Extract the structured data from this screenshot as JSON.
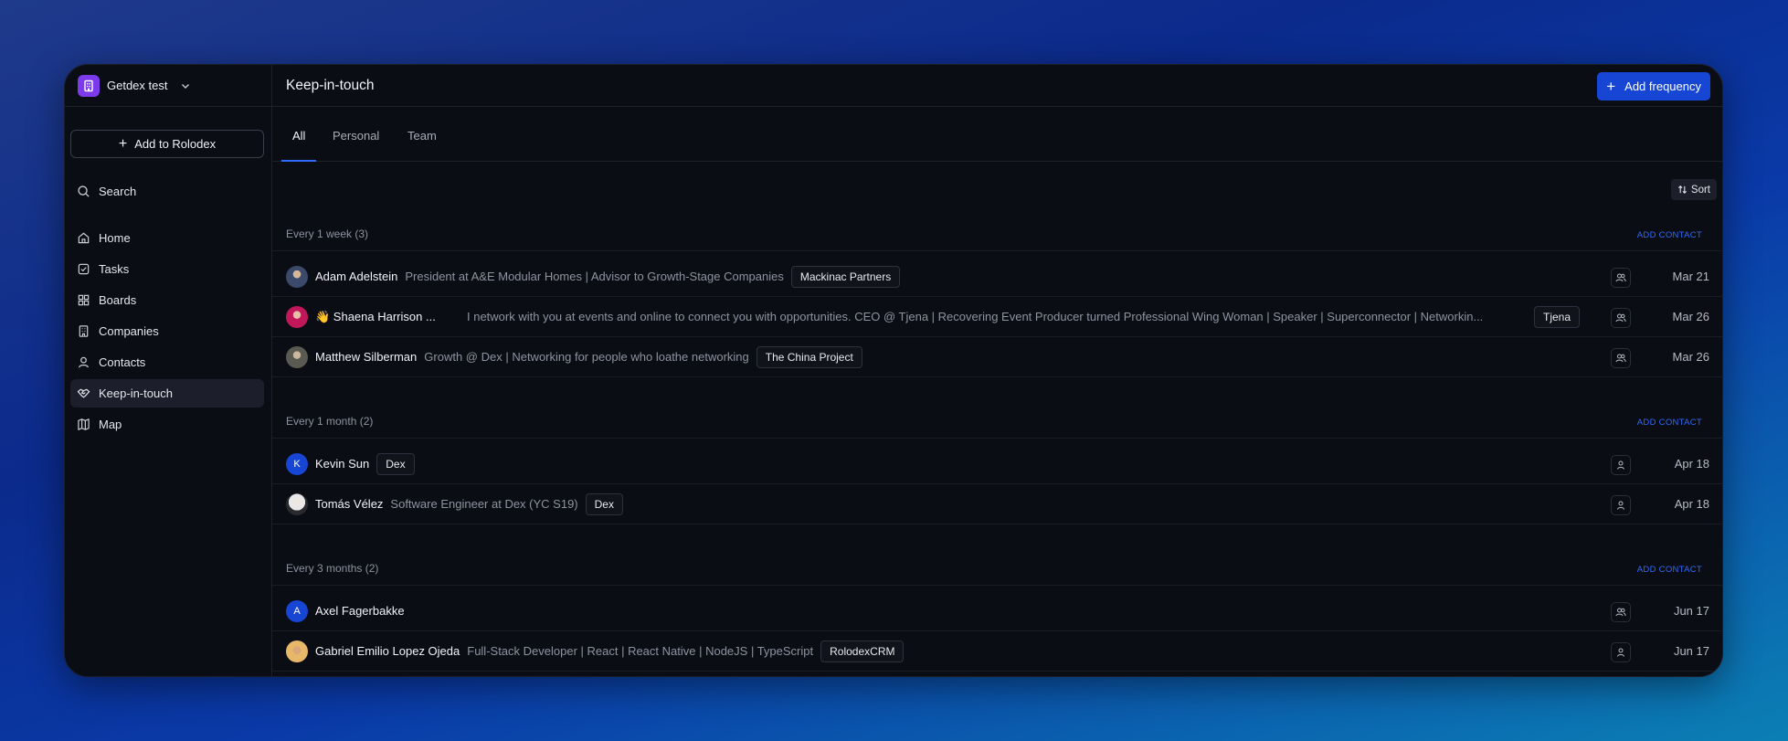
{
  "workspace": {
    "name": "Getdex test"
  },
  "sidebar": {
    "add_button": "Add to Rolodex",
    "search": "Search",
    "items": [
      {
        "label": "Home",
        "icon": "home-icon"
      },
      {
        "label": "Tasks",
        "icon": "tasks-icon"
      },
      {
        "label": "Boards",
        "icon": "boards-icon"
      },
      {
        "label": "Companies",
        "icon": "companies-icon"
      },
      {
        "label": "Contacts",
        "icon": "contacts-icon"
      },
      {
        "label": "Keep-in-touch",
        "icon": "handshake-icon",
        "active": true
      },
      {
        "label": "Map",
        "icon": "map-icon"
      }
    ]
  },
  "header": {
    "title": "Keep-in-touch",
    "add_frequency": "Add frequency"
  },
  "tabs": [
    "All",
    "Personal",
    "Team"
  ],
  "sort_label": "Sort",
  "groups": [
    {
      "label": "Every 1 week (3)",
      "add_contact": "ADD CONTACT",
      "contacts": [
        {
          "name": "Adam Adelstein",
          "desc": "President at A&E Modular Homes | Advisor to Growth-Stage Companies",
          "company": "Mackinac Partners",
          "date": "Mar 21",
          "type": "team"
        },
        {
          "name": "👋 Shaena Harrison ...",
          "desc": "I network with you at events and online to connect you with opportunities. CEO @ Tjena | Recovering Event Producer turned Professional Wing Woman | Speaker | Superconnector | Networkin...",
          "company": "Tjena",
          "date": "Mar 26",
          "type": "team"
        },
        {
          "name": "Matthew Silberman",
          "desc": "Growth @ Dex | Networking for people who loathe networking",
          "company": "The China Project",
          "date": "Mar 26",
          "type": "team"
        }
      ]
    },
    {
      "label": "Every 1 month (2)",
      "add_contact": "ADD CONTACT",
      "contacts": [
        {
          "name": "Kevin Sun",
          "initial": "K",
          "desc": "",
          "company": "Dex",
          "date": "Apr 18",
          "type": "personal"
        },
        {
          "name": "Tomás Vélez",
          "desc": "Software Engineer at Dex (YC S19)",
          "company": "Dex",
          "date": "Apr 18",
          "type": "personal"
        }
      ]
    },
    {
      "label": "Every 3 months (2)",
      "add_contact": "ADD CONTACT",
      "contacts": [
        {
          "name": "Axel Fagerbakke",
          "initial": "A",
          "desc": "",
          "company": "",
          "date": "Jun 17",
          "type": "team"
        },
        {
          "name": "Gabriel Emilio Lopez Ojeda",
          "desc": "Full-Stack Developer | React | React Native | NodeJS | TypeScript",
          "company": "RolodexCRM",
          "date": "Jun 17",
          "type": "personal"
        }
      ]
    }
  ],
  "colors": {
    "accent": "#1746d4",
    "link": "#2f6bff",
    "workspace_logo": "#7c3aed",
    "background": "#0b0d14"
  }
}
